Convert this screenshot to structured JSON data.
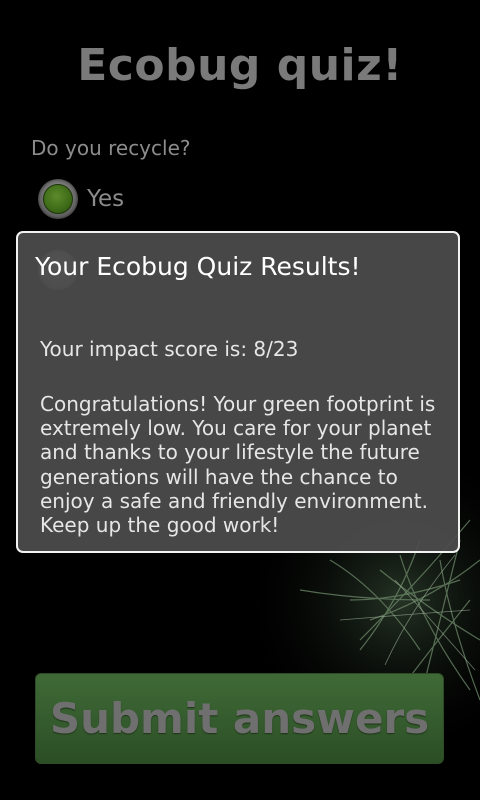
{
  "app": {
    "title": "Ecobug quiz!"
  },
  "quiz": {
    "question": "Do you recycle?",
    "options": [
      {
        "label": "Yes",
        "selected": true
      },
      {
        "label": "",
        "selected": false
      }
    ]
  },
  "dialog": {
    "title": "Your Ecobug Quiz Results!",
    "score_text": "Your impact score is: 8/23",
    "message": "Congratulations! Your green footprint is extremely low. You care for your planet and thanks to your lifestyle the future generations will have the chance to enjoy a safe and friendly environment. Keep up the good work!"
  },
  "submit": {
    "label": "Submit answers"
  },
  "colors": {
    "background": "#000000",
    "accent_green": "#3f6a36",
    "dialog_border": "#f2f2f2"
  }
}
